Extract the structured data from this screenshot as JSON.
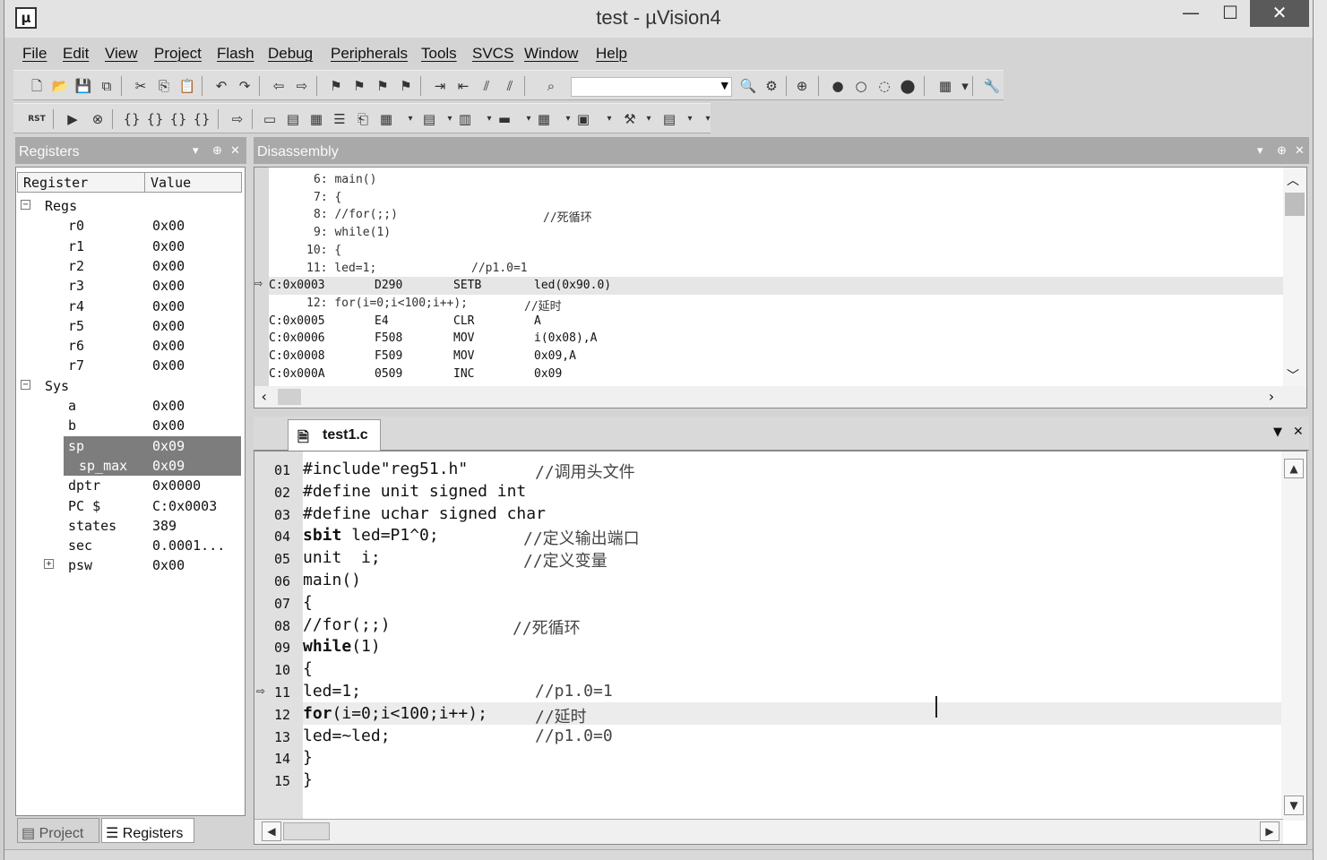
{
  "window": {
    "title": "test  - µVision4",
    "app_icon": "uv-logo-icon",
    "controls": {
      "minimize": "—",
      "maximize": "☐",
      "close": "✕"
    }
  },
  "menu": [
    "File",
    "Edit",
    "View",
    "Project",
    "Flash",
    "Debug",
    "Peripherals",
    "Tools",
    "SVCS",
    "Window",
    "Help"
  ],
  "toolbar1": {
    "combo_value": ""
  },
  "toolbar2": {
    "reset_label": "RST"
  },
  "registers_panel": {
    "title": "Registers",
    "columns": [
      "Register",
      "Value"
    ],
    "groups": [
      {
        "label": "Regs",
        "expander": "−",
        "rows": [
          {
            "name": "r0",
            "value": "0x00"
          },
          {
            "name": "r1",
            "value": "0x00"
          },
          {
            "name": "r2",
            "value": "0x00"
          },
          {
            "name": "r3",
            "value": "0x00"
          },
          {
            "name": "r4",
            "value": "0x00"
          },
          {
            "name": "r5",
            "value": "0x00"
          },
          {
            "name": "r6",
            "value": "0x00"
          },
          {
            "name": "r7",
            "value": "0x00"
          }
        ]
      },
      {
        "label": "Sys",
        "expander": "−",
        "rows": [
          {
            "name": "a",
            "value": "0x00"
          },
          {
            "name": "b",
            "value": "0x00"
          },
          {
            "name": "sp",
            "value": "0x09"
          },
          {
            "name": "sp_max",
            "value": "0x09"
          },
          {
            "name": "dptr",
            "value": "0x0000"
          },
          {
            "name": "PC  $",
            "value": "C:0x0003"
          },
          {
            "name": "states",
            "value": "389"
          },
          {
            "name": "sec",
            "value": "0.0001..."
          },
          {
            "name": "psw",
            "value": "0x00",
            "expander": "+"
          }
        ]
      }
    ],
    "tabs": [
      "Project",
      "Registers"
    ]
  },
  "disassembly_panel": {
    "title": "Disassembly",
    "rows": [
      {
        "a": "6: main()",
        "b": ""
      },
      {
        "a": "7: {",
        "b": ""
      },
      {
        "a": "8: //for(;;)",
        "b": "//死循环"
      },
      {
        "a": "9: while(1)",
        "b": ""
      },
      {
        "a": "10: {",
        "b": ""
      },
      {
        "a": "11: led=1;",
        "b": "//p1.0=1"
      },
      {
        "addr": "C:0x0003",
        "hex": "D290",
        "mn": "SETB",
        "op": "led(0x90.0)",
        "current": true
      },
      {
        "a": "12: for(i=0;i<100;i++);",
        "b": "//延时"
      },
      {
        "addr": "C:0x0005",
        "hex": "E4",
        "mn": "CLR",
        "op": "A"
      },
      {
        "addr": "C:0x0006",
        "hex": "F508",
        "mn": "MOV",
        "op": "i(0x08),A"
      },
      {
        "addr": "C:0x0008",
        "hex": "F509",
        "mn": "MOV",
        "op": "0x09,A"
      },
      {
        "addr": "C:0x000A",
        "hex": "0509",
        "mn": "INC",
        "op": "0x09"
      }
    ]
  },
  "editor": {
    "tab_label": "test1.c",
    "lines": [
      {
        "n": "01",
        "code": "#include\"reg51.h\"",
        "comment": "//调用头文件"
      },
      {
        "n": "02",
        "code": "#define unit signed int",
        "comment": ""
      },
      {
        "n": "03",
        "code": "#define uchar signed char",
        "comment": ""
      },
      {
        "n": "04",
        "kw": "sbit",
        "code": " led=P1^0;",
        "comment": "//定义输出端口"
      },
      {
        "n": "05",
        "code": "unit  i;",
        "comment": "//定义变量"
      },
      {
        "n": "06",
        "code": "main()",
        "comment": ""
      },
      {
        "n": "07",
        "code": "{",
        "comment": ""
      },
      {
        "n": "08",
        "code": "//for(;;)",
        "comment": "//死循环"
      },
      {
        "n": "09",
        "kw": "while",
        "code": "(1)",
        "comment": ""
      },
      {
        "n": "10",
        "code": "{",
        "comment": ""
      },
      {
        "n": "11",
        "code": "led=1;",
        "comment": "//p1.0=1"
      },
      {
        "n": "12",
        "kw": "for",
        "code": "(i=0;i<100;i++);",
        "comment": "//延时"
      },
      {
        "n": "13",
        "code": "led=~led;",
        "comment": "//p1.0=0"
      },
      {
        "n": "14",
        "code": "}",
        "comment": ""
      },
      {
        "n": "15",
        "code": "}",
        "comment": ""
      }
    ]
  }
}
